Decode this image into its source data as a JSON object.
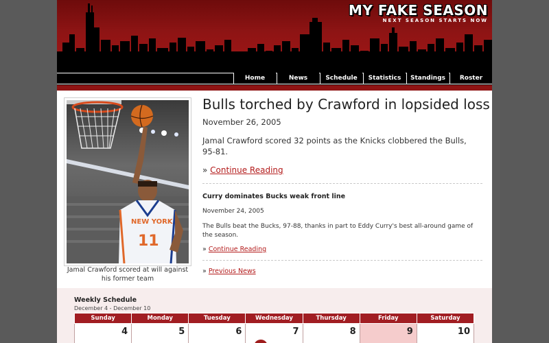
{
  "site": {
    "title": "MY FAKE SEASON",
    "tagline": "NEXT SEASON STARTS NOW"
  },
  "nav": [
    "Home",
    "News",
    "Schedule",
    "Statistics",
    "Standings",
    "Roster"
  ],
  "photo": {
    "caption": "Jamal Crawford scored at will against his former team",
    "jersey_text": "NEW YORK",
    "jersey_number": "11"
  },
  "main_story": {
    "title": "Bulls torched by Crawford in lopsided loss",
    "date": "November 26, 2005",
    "summary": "Jamal Crawford scored 32 points as the Knicks clobbered the Bulls, 95-81.",
    "more_prefix": "» ",
    "more_label": "Continue Reading"
  },
  "secondary_story": {
    "title": "Curry dominates Bucks weak front line",
    "date": "November 24, 2005",
    "summary": "The Bulls beat the Bucks, 97-88, thanks in part to Eddy Curry's best all-around game of the season.",
    "more_prefix": "» ",
    "more_label": "Continue Reading"
  },
  "previous_news": {
    "prefix": "» ",
    "label": "Previous News"
  },
  "schedule": {
    "title": "Weekly Schedule",
    "range": "December 4 - December 10",
    "days": [
      "Sunday",
      "Monday",
      "Tuesday",
      "Wednesday",
      "Thursday",
      "Friday",
      "Saturday"
    ],
    "dates": [
      "4",
      "5",
      "6",
      "7",
      "8",
      "9",
      "10"
    ],
    "highlight_day": "Friday",
    "game_days": [
      "Wednesday"
    ]
  },
  "colors": {
    "brand_red": "#a11d22",
    "header_dark": "#6e0b0b",
    "link": "#b31b1b",
    "highlight": "#f5cccc"
  }
}
